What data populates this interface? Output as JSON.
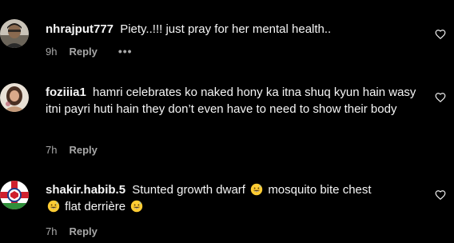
{
  "comments": [
    {
      "username": "nhrajput777",
      "text": "Piety..!!! just pray for her mental health..",
      "time": "9h",
      "reply_label": "Reply",
      "more_label": "•••",
      "avatar_icon": "user-avatar-man"
    },
    {
      "username": "foziiia1",
      "text": "hamri celebrates ko naked hony ka itna shuq kyun hain wasy itni payri huti hain they don’t even have to need to show their body",
      "time": "7h",
      "reply_label": "Reply",
      "avatar_icon": "user-avatar-woman"
    },
    {
      "username": "shakir.habib.5",
      "text_parts": [
        "Stunted growth dwarf",
        "mosquito bite chest",
        "flat derrière",
        ""
      ],
      "emoji_icon": "grinning-sweat-emoji",
      "time": "7h",
      "reply_label": "Reply",
      "avatar_icon": "user-avatar-england-flag"
    }
  ],
  "colors": {
    "background": "#000000",
    "primary_text": "#f5f5f5",
    "secondary_text": "#a8a8a8"
  },
  "icons": {
    "like": "heart-outline-icon"
  }
}
